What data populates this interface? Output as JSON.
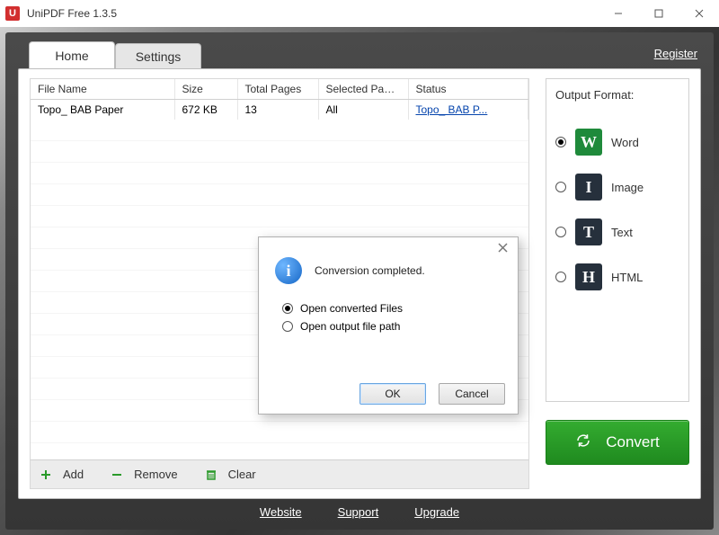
{
  "window": {
    "title": "UniPDF Free 1.3.5",
    "app_icon_letter": "U"
  },
  "tabs": {
    "home": "Home",
    "settings": "Settings",
    "register": "Register"
  },
  "columns": {
    "name": "File Name",
    "size": "Size",
    "pages": "Total Pages",
    "selected": "Selected Pages",
    "status": "Status"
  },
  "rows": [
    {
      "name": "Topo_ BAB Paper",
      "size": "672 KB",
      "pages": "13",
      "selected": "All",
      "status": "Topo_  BAB P..."
    }
  ],
  "toolbar": {
    "add": "Add",
    "remove": "Remove",
    "clear": "Clear"
  },
  "output": {
    "title": "Output Format:",
    "items": [
      {
        "key": "word",
        "label": "Word",
        "glyph": "W",
        "css": "ic-word",
        "checked": true
      },
      {
        "key": "image",
        "label": "Image",
        "glyph": "I",
        "css": "ic-image",
        "checked": false
      },
      {
        "key": "text",
        "label": "Text",
        "glyph": "T",
        "css": "ic-text",
        "checked": false
      },
      {
        "key": "html",
        "label": "HTML",
        "glyph": "H",
        "css": "ic-html",
        "checked": false
      }
    ]
  },
  "convert": {
    "label": "Convert"
  },
  "footer_links": {
    "website": "Website",
    "support": "Support",
    "upgrade": "Upgrade"
  },
  "dialog": {
    "message": "Conversion completed.",
    "opt_open_files": "Open converted Files",
    "opt_open_path": "Open output file path",
    "ok": "OK",
    "cancel": "Cancel"
  }
}
